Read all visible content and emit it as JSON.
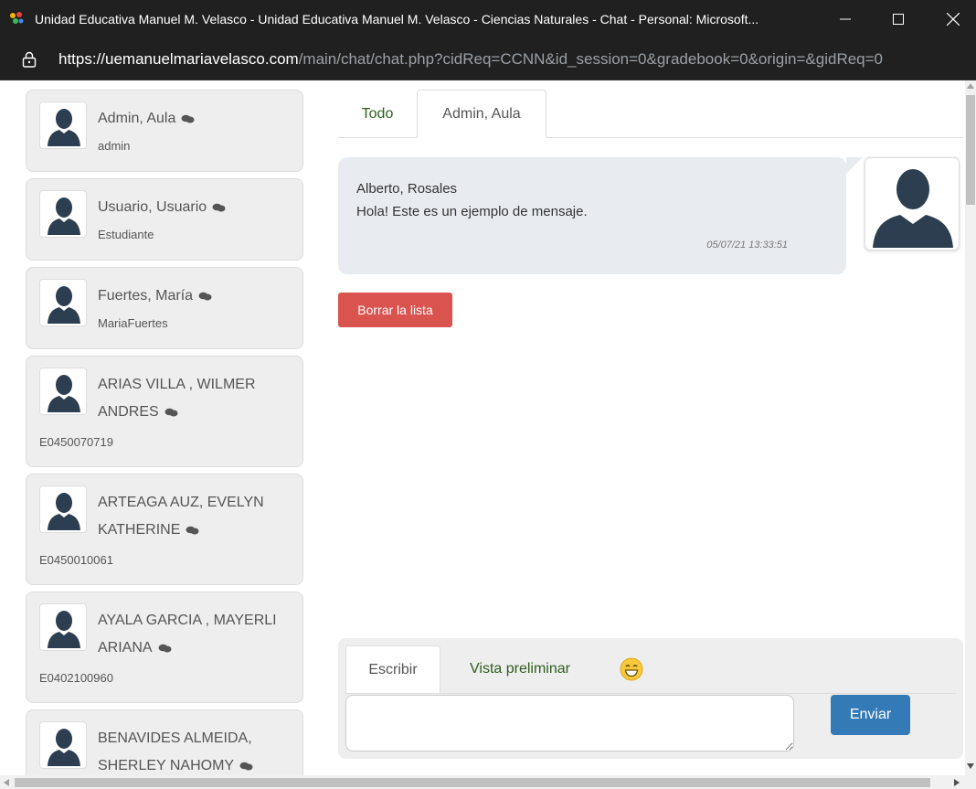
{
  "window": {
    "title": "Unidad Educativa Manuel M. Velasco - Unidad Educativa Manuel M. Velasco - Ciencias Naturales - Chat - Personal: Microsoft...",
    "url_host": "https://uemanuelmariavelasco.com",
    "url_path": "/main/chat/chat.php?cidReq=CCNN&id_session=0&gradebook=0&origin=&gidReq=0"
  },
  "contacts": [
    {
      "name": "Admin, Aula",
      "sub": "admin"
    },
    {
      "name": "Usuario, Usuario",
      "sub": "Estudiante"
    },
    {
      "name": "Fuertes, María",
      "sub": "MariaFuertes"
    },
    {
      "name": "ARIAS VILLA , WILMER ANDRES",
      "sub": "E0450070719"
    },
    {
      "name": "ARTEAGA AUZ, EVELYN KATHERINE",
      "sub": "E0450010061"
    },
    {
      "name": "AYALA GARCIA , MAYERLI ARIANA",
      "sub": "E0402100960"
    },
    {
      "name": "BENAVIDES ALMEIDA, SHERLEY NAHOMY",
      "sub": ""
    }
  ],
  "tabs": {
    "all": "Todo",
    "active": "Admin, Aula"
  },
  "message": {
    "sender": "Alberto, Rosales",
    "text": "Hola! Este es un ejemplo de mensaje.",
    "time": "05/07/21 13:33:51"
  },
  "clear_button": "Borrar la lista",
  "composer": {
    "write_tab": "Escribir",
    "preview_tab": "Vista preliminar",
    "send_button": "Enviar",
    "input_value": ""
  },
  "colors": {
    "tab_link": "#2f5c1f",
    "danger": "#d9534f",
    "primary": "#337ab7",
    "avatar": "#2c3e50"
  },
  "icons": {
    "contact_avatar": "user-silhouette-icon",
    "chat_status": "chat-bubble-icon",
    "emoji": "grin-emoji-icon",
    "lock": "lock-icon"
  }
}
